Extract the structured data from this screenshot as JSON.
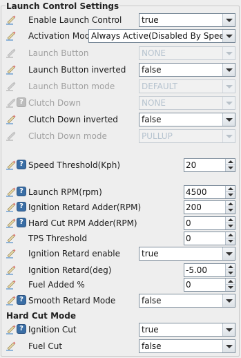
{
  "sections": {
    "launch_control": "Launch Control Settings",
    "hard_cut_mode": "Hard Cut Mode"
  },
  "rows": {
    "enable_launch_control": {
      "label": "Enable Launch Control",
      "value": "true"
    },
    "activation_mode": {
      "label": "Activation Mode",
      "value": "Always Active(Disabled By Speed)"
    },
    "launch_button": {
      "label": "Launch Button",
      "value": "NONE"
    },
    "launch_button_inverted": {
      "label": "Launch Button inverted",
      "value": "false"
    },
    "launch_button_mode": {
      "label": "Launch Button mode",
      "value": "DEFAULT"
    },
    "clutch_down": {
      "label": "Clutch Down",
      "value": "NONE"
    },
    "clutch_down_inverted": {
      "label": "Clutch Down inverted",
      "value": "false"
    },
    "clutch_down_mode": {
      "label": "Clutch Down mode",
      "value": "PULLUP"
    },
    "speed_threshold": {
      "label": "Speed Threshold(Kph)",
      "value": "20"
    },
    "launch_rpm": {
      "label": "Launch RPM(rpm)",
      "value": "4500"
    },
    "ignition_retard_adder": {
      "label": "Ignition Retard Adder(RPM)",
      "value": "200"
    },
    "hard_cut_rpm_adder": {
      "label": "Hard Cut RPM Adder(RPM)",
      "value": "0"
    },
    "tps_threshold": {
      "label": "TPS Threshold",
      "value": "0"
    },
    "ignition_retard_enable": {
      "label": "Ignition Retard enable",
      "value": "true"
    },
    "ignition_retard": {
      "label": "Ignition Retard(deg)",
      "value": "-5.00"
    },
    "fuel_added": {
      "label": "Fuel Added %",
      "value": "0"
    },
    "smooth_retard_mode": {
      "label": "Smooth Retard Mode",
      "value": "false"
    },
    "ignition_cut": {
      "label": "Ignition Cut",
      "value": "true"
    },
    "fuel_cut": {
      "label": "Fuel Cut",
      "value": "false"
    }
  },
  "help_glyph": "?",
  "icons": {
    "edit": "pencil-edit-icon",
    "help": "help-icon"
  },
  "colors": {
    "help_blue": "#3a6ea5",
    "disabled_text": "#a0a0a0",
    "disabled_value": "#b6c3cf"
  }
}
